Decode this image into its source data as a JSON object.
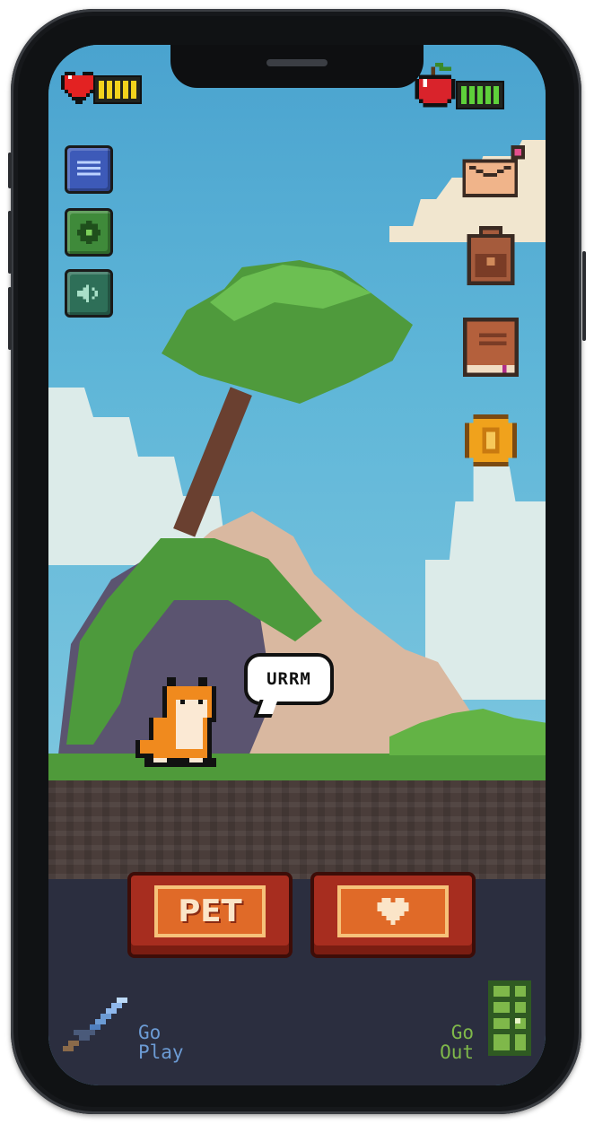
{
  "hud": {
    "health": {
      "icon": "heart-icon",
      "filled_segments": 5,
      "total_segments": 5,
      "color": "#f2d21c"
    },
    "hunger": {
      "icon": "apple-icon",
      "filled_segments": 5,
      "total_segments": 5,
      "color": "#5ed13a"
    }
  },
  "left_menu": [
    {
      "name": "menu-button",
      "icon": "list-icon",
      "color": "#3d5ab8"
    },
    {
      "name": "settings-button",
      "icon": "gear-icon",
      "color": "#3f8a3a"
    },
    {
      "name": "sound-button",
      "icon": "speaker-icon",
      "color": "#2e6f58"
    }
  ],
  "right_menu": [
    {
      "name": "mail-button",
      "icon": "envelope-icon",
      "has_notification": true
    },
    {
      "name": "backpack-button",
      "icon": "backpack-icon"
    },
    {
      "name": "journal-button",
      "icon": "book-icon"
    },
    {
      "name": "coin-button",
      "icon": "coin-icon"
    }
  ],
  "pet": {
    "speech": "URRM"
  },
  "actions": {
    "pet_label": "PET",
    "love_icon": "heart-icon"
  },
  "footer": {
    "play": {
      "line1": "Go",
      "line2": "Play",
      "icon": "sword-icon",
      "color": "#6c9bd4"
    },
    "out": {
      "line1": "Go",
      "line2": "Out",
      "icon": "door-icon",
      "color": "#7fb84a"
    }
  },
  "colors": {
    "sky": "#5fb6d8",
    "grass": "#4f9a3a",
    "dirt": "#4a3d3a",
    "panel": "#2b2e3f",
    "button": "#a72d1f"
  }
}
